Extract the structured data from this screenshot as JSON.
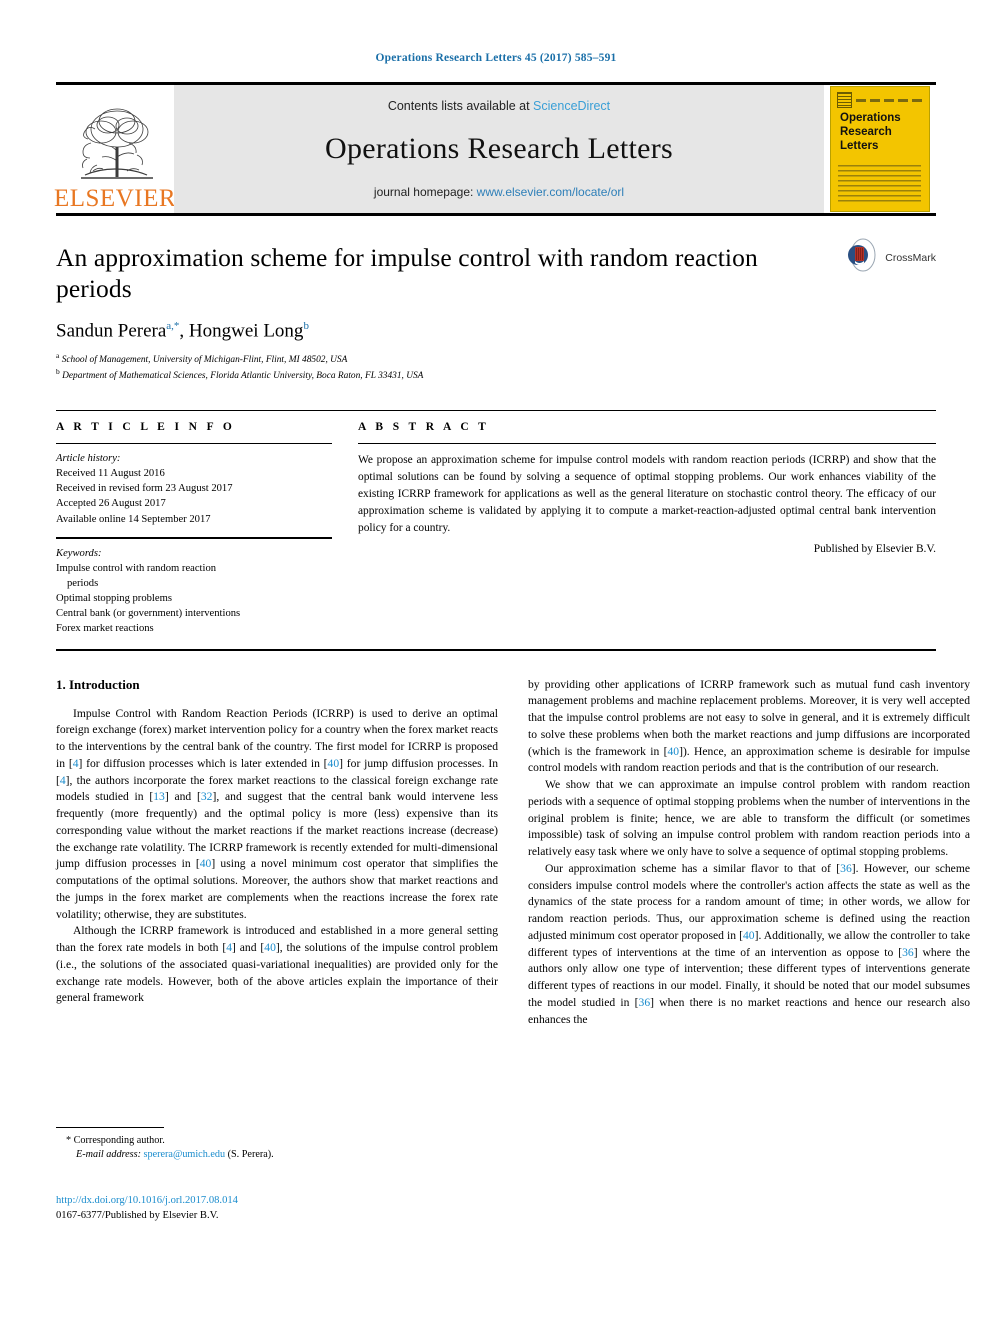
{
  "running_head": "Operations Research Letters 45 (2017) 585–591",
  "banner": {
    "publisher_wordmark": "ELSEVIER",
    "contents_prefix": "Contents lists available at ",
    "contents_link": "ScienceDirect",
    "journal_title": "Operations Research Letters",
    "homepage_prefix": "journal homepage: ",
    "homepage_url": "www.elsevier.com/locate/orl",
    "cover_title": "Operations Research Letters"
  },
  "article": {
    "title": "An approximation scheme for impulse control with random reaction periods",
    "authors_plain": "Sandun Perera",
    "author1": "Sandun Perera",
    "author1_sup": "a,",
    "author1_star": "*",
    "author2": "Hongwei Long",
    "author2_sup": "b",
    "affiliation_a_marker": "a",
    "affiliation_a": "School of Management, University of Michigan-Flint, Flint, MI 48502, USA",
    "affiliation_b_marker": "b",
    "affiliation_b": "Department of Mathematical Sciences, Florida Atlantic University, Boca Raton, FL 33431, USA",
    "crossmark_label": "CrossMark"
  },
  "info": {
    "heading": "A R T I C L E   I N F O",
    "history_label": "Article history:",
    "history": [
      "Received 11 August 2016",
      "Received in revised form 23 August 2017",
      "Accepted 26 August 2017",
      "Available online 14 September 2017"
    ],
    "keywords_label": "Keywords:",
    "keywords": [
      "Impulse control with random reaction",
      "periods",
      "Optimal stopping problems",
      "Central bank (or government) interventions",
      "Forex market reactions"
    ]
  },
  "abstract": {
    "heading": "A B S T R A C T",
    "text": "We propose an approximation scheme for impulse control models with random reaction periods (ICRRP) and show that the optimal solutions can be found by solving a sequence of optimal stopping problems. Our work enhances viability of the existing ICRRP framework for applications as well as the general literature on stochastic control theory. The efficacy of our approximation scheme is validated by applying it to compute a market-reaction-adjusted optimal central bank intervention policy for a country.",
    "published_by": "Published by Elsevier B.V."
  },
  "body": {
    "section_title": "1.  Introduction",
    "left_paragraphs": [
      "Impulse Control with Random Reaction Periods (ICRRP) is used to derive an optimal foreign exchange (forex) market intervention policy for a country when the forex market reacts to the interventions by the central bank of the country. The first model for ICRRP is proposed in [4] for diffusion processes which is later extended in [40] for jump diffusion processes. In [4], the authors incorporate the forex market reactions to the classical foreign exchange rate models studied in [13] and [32], and suggest that the central bank would intervene less frequently (more frequently) and the optimal policy is more (less) expensive than its corresponding value without the market reactions if the market reactions increase (decrease) the exchange rate volatility. The ICRRP framework is recently extended for multi-dimensional jump diffusion processes in [40] using a novel minimum cost operator that simplifies the computations of the optimal solutions. Moreover, the authors show that market reactions and the jumps in the forex market are complements when the reactions increase the forex rate volatility; otherwise, they are substitutes.",
      "Although the ICRRP framework is introduced and established in a more general setting than the forex rate models in both [4] and [40], the solutions of the impulse control problem (i.e., the solutions of the associated quasi-variational inequalities) are provided only for the exchange rate models. However, both of the above articles explain the importance of their general framework"
    ],
    "right_paragraphs": [
      "by providing other applications of ICRRP framework such as mutual fund cash inventory management problems and machine replacement problems. Moreover, it is very well accepted that the impulse control problems are not easy to solve in general, and it is extremely difficult to solve these problems when both the market reactions and jump diffusions are incorporated (which is the framework in [40]). Hence, an approximation scheme is desirable for impulse control models with random reaction periods and that is the contribution of our research.",
      "We show that we can approximate an impulse control problem with random reaction periods with a sequence of optimal stopping problems when the number of interventions in the original problem is finite; hence, we are able to transform the difficult (or sometimes impossible) task of solving an impulse control problem with random reaction periods into a relatively easy task where we only have to solve a sequence of optimal stopping problems.",
      "Our approximation scheme has a similar flavor to that of [36]. However, our scheme considers impulse control models where the controller's action affects the state as well as the dynamics of the state process for a random amount of time; in other words, we allow for random reaction periods. Thus, our approximation scheme is defined using the reaction adjusted minimum cost operator proposed in [40]. Additionally, we allow the controller to take different types of interventions at the time of an intervention as oppose to [36] where the authors only allow one type of intervention; these different types of interventions generate different types of reactions in our model. Finally, it should be noted that our model subsumes the model studied in [36] when there is no market reactions and hence our research also enhances the"
    ]
  },
  "footer": {
    "corresponding_marker": "*",
    "corresponding_label": "Corresponding author.",
    "email_label": "E-mail address:",
    "email": "sperera@umich.edu",
    "email_suffix": "(S. Perera).",
    "doi": "http://dx.doi.org/10.1016/j.orl.2017.08.014",
    "issn_line": "0167-6377/Published by Elsevier B.V."
  },
  "colors": {
    "link_blue": "#1a8ccd",
    "header_blue": "#1a6fa8",
    "elsevier_orange": "#E87722",
    "cover_yellow": "#F3C500",
    "banner_gray": "#e6e6e6"
  }
}
